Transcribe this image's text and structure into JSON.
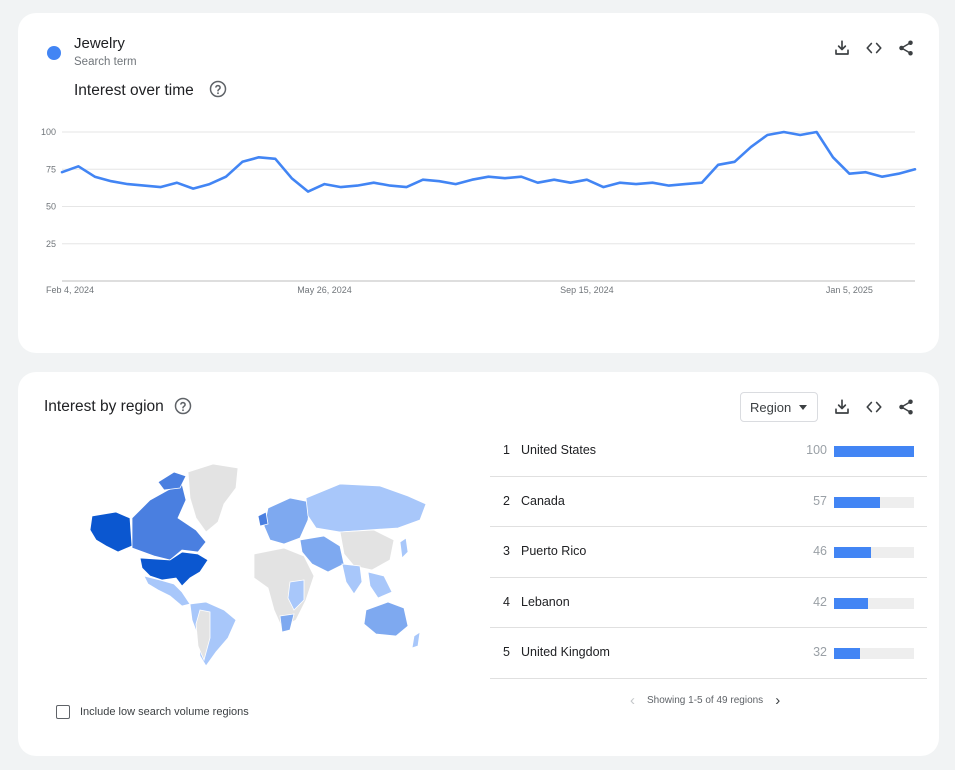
{
  "search_term": {
    "name": "Jewelry",
    "type_label": "Search term",
    "color": "#4285f4"
  },
  "interest_over_time": {
    "title": "Interest over time",
    "help_icon": "help-circle-icon",
    "actions": [
      "download-icon",
      "embed-code-icon",
      "share-icon"
    ]
  },
  "chart_data": {
    "type": "line",
    "ylim": [
      0,
      100
    ],
    "yticks": [
      25,
      50,
      75,
      100
    ],
    "grid": true,
    "x_tick_labels": [
      "Feb 4, 2024",
      "May 26, 2024",
      "Sep 15, 2024",
      "Jan 5, 2025"
    ],
    "x_tick_index": [
      0,
      16,
      32,
      48
    ],
    "series": [
      {
        "color": "#4285f4",
        "values": [
          73,
          77,
          70,
          67,
          65,
          64,
          63,
          66,
          62,
          65,
          70,
          80,
          83,
          82,
          69,
          60,
          65,
          63,
          64,
          66,
          64,
          63,
          68,
          67,
          65,
          68,
          70,
          69,
          70,
          66,
          68,
          66,
          68,
          63,
          66,
          65,
          66,
          64,
          65,
          66,
          78,
          80,
          90,
          98,
          100,
          98,
          100,
          83,
          72,
          73,
          70,
          72,
          75
        ]
      }
    ]
  },
  "interest_by_region": {
    "title": "Interest by region",
    "help_icon": "help-circle-icon",
    "select_label": "Region",
    "actions": [
      "download-icon",
      "embed-code-icon",
      "share-icon"
    ],
    "rows": [
      {
        "rank": "1",
        "name": "United States",
        "value": "100",
        "fraction": 1.0
      },
      {
        "rank": "2",
        "name": "Canada",
        "value": "57",
        "fraction": 0.57
      },
      {
        "rank": "3",
        "name": "Puerto Rico",
        "value": "46",
        "fraction": 0.46
      },
      {
        "rank": "4",
        "name": "Lebanon",
        "value": "42",
        "fraction": 0.42
      },
      {
        "rank": "5",
        "name": "United Kingdom",
        "value": "32",
        "fraction": 0.32
      }
    ],
    "pager_text": "Showing 1-5 of 49 regions",
    "checkbox_label": "Include low search volume regions",
    "checkbox_checked": false,
    "map_colors": {
      "max": "#0b57d0",
      "high": "#4a7fe0",
      "mid": "#7ea9f0",
      "low": "#a8c7fa",
      "none": "#e3e3e3"
    }
  }
}
